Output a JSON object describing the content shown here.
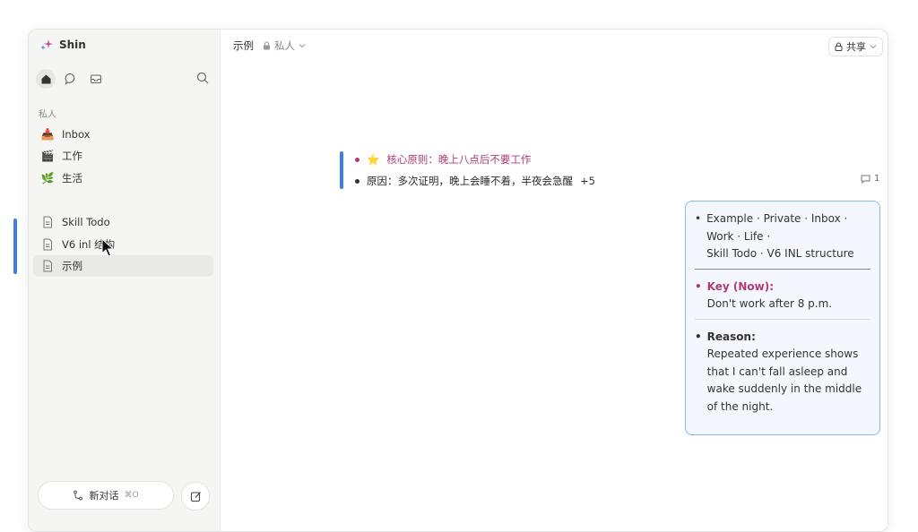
{
  "app": {
    "name": "Shin"
  },
  "sidebar": {
    "section_label": "私人",
    "items": [
      {
        "label": "Inbox",
        "icon": "📥"
      },
      {
        "label": "工作",
        "icon": "🎬"
      },
      {
        "label": "生活",
        "icon": "🌿"
      }
    ],
    "docs": [
      {
        "label": "Skill Todo"
      },
      {
        "label": "V6 inl 结构"
      },
      {
        "label": "示例"
      }
    ],
    "new_chat": {
      "label": "新对话",
      "shortcut": "⌘O"
    }
  },
  "topbar": {
    "title": "示例",
    "privacy": "私人",
    "share": "共享"
  },
  "content": {
    "bullets": [
      {
        "star": "⭐",
        "text": "核心原则：晚上八点后不要工作"
      },
      {
        "text": "原因：多次证明，晚上会睡不着，半夜会急醒",
        "extra": "+5"
      }
    ],
    "comment_count": "1"
  },
  "card": {
    "line1": "Example · Private · Inbox ·",
    "line2": "Work · Life ·",
    "line3": "Skill Todo · V6 INL structure",
    "key_label": "Key (Now):",
    "key_text": "Don't work after 8 p.m.",
    "reason_label": "Reason:",
    "reason_lines": [
      "Repeated experience shows",
      "that I can't fall asleep and",
      "wake suddenly in the middle",
      "of the night."
    ]
  },
  "colors": {
    "accent_blue": "#3f7ee8",
    "pink": "#b03a78"
  }
}
